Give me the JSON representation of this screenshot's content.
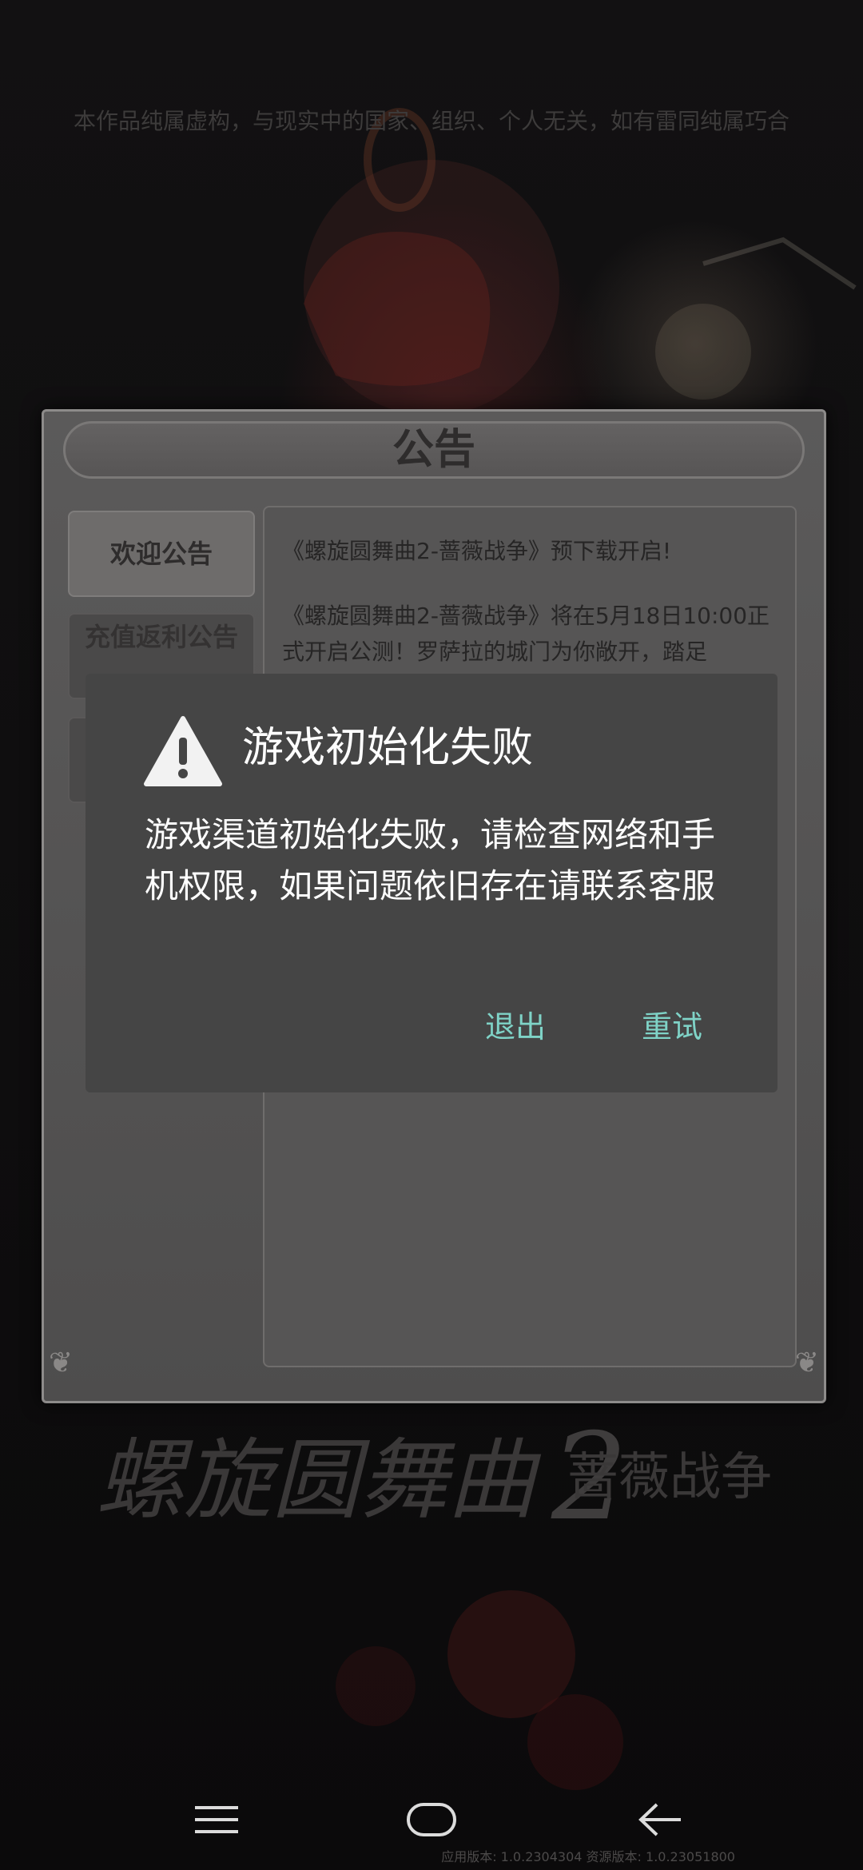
{
  "disclaimer": "本作品纯属虚构，与现实中的国家、组织、个人无关，如有雷同纯属巧合",
  "announcement": {
    "title": "公告",
    "tabs": [
      {
        "label": "欢迎公告"
      },
      {
        "label": "充值返利公告"
      },
      {
        "label": ""
      }
    ],
    "content": {
      "line1": "《螺旋圆舞曲2-蔷薇战争》预下载开启!",
      "line2": "《螺旋圆舞曲2-蔷薇战争》将在5月18日10:00正式开启公测！罗萨拉的城门为你敞开，踏足"
    }
  },
  "dialog": {
    "title": "游戏初始化失败",
    "message": "游戏渠道初始化失败，请检查网络和手机权限，如果问题依旧存在请联系客服",
    "exit_label": "退出",
    "retry_label": "重试"
  },
  "logo_text": {
    "main": "螺旋圆舞曲",
    "number": "2",
    "sub": "蔷薇战争"
  },
  "navbar": {
    "icons": [
      "menu-icon",
      "home-icon",
      "back-icon"
    ]
  },
  "version_text": "应用版本: 1.0.2304304 资源版本: 1.0.23051800",
  "colors": {
    "accent": "#7fd3c7",
    "dialog_bg": "#454545",
    "panel_bg": "#5b5a5a"
  }
}
